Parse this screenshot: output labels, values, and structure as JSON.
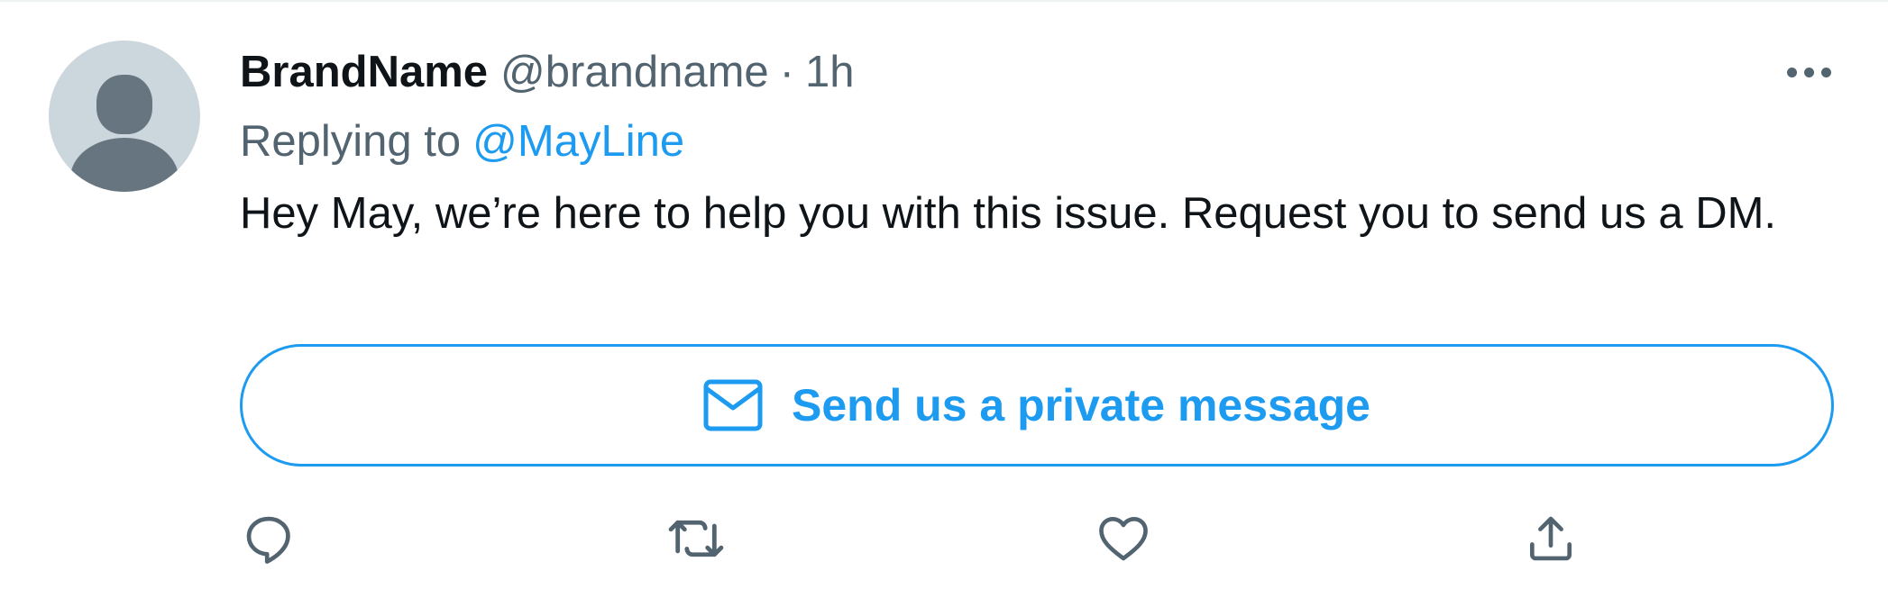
{
  "tweet": {
    "display_name": "BrandName",
    "handle": "@brandname",
    "separator": "·",
    "time": "1h",
    "replying_prefix": "Replying to",
    "replying_to": "@MayLine",
    "text": "Hey May, we’re here to help you with this issue. Request you to send us a DM."
  },
  "dm_button": {
    "label": "Send us a private message",
    "icon": "mail-icon"
  },
  "actions": [
    {
      "name": "reply",
      "icon": "reply-icon"
    },
    {
      "name": "retweet",
      "icon": "retweet-icon"
    },
    {
      "name": "like",
      "icon": "heart-icon"
    },
    {
      "name": "share",
      "icon": "share-icon"
    }
  ],
  "colors": {
    "accent": "#1d9bf0",
    "secondary_text": "#536471",
    "primary_text": "#0f1419",
    "avatar_bg": "#ccd6dd",
    "avatar_fg": "#66757f"
  }
}
